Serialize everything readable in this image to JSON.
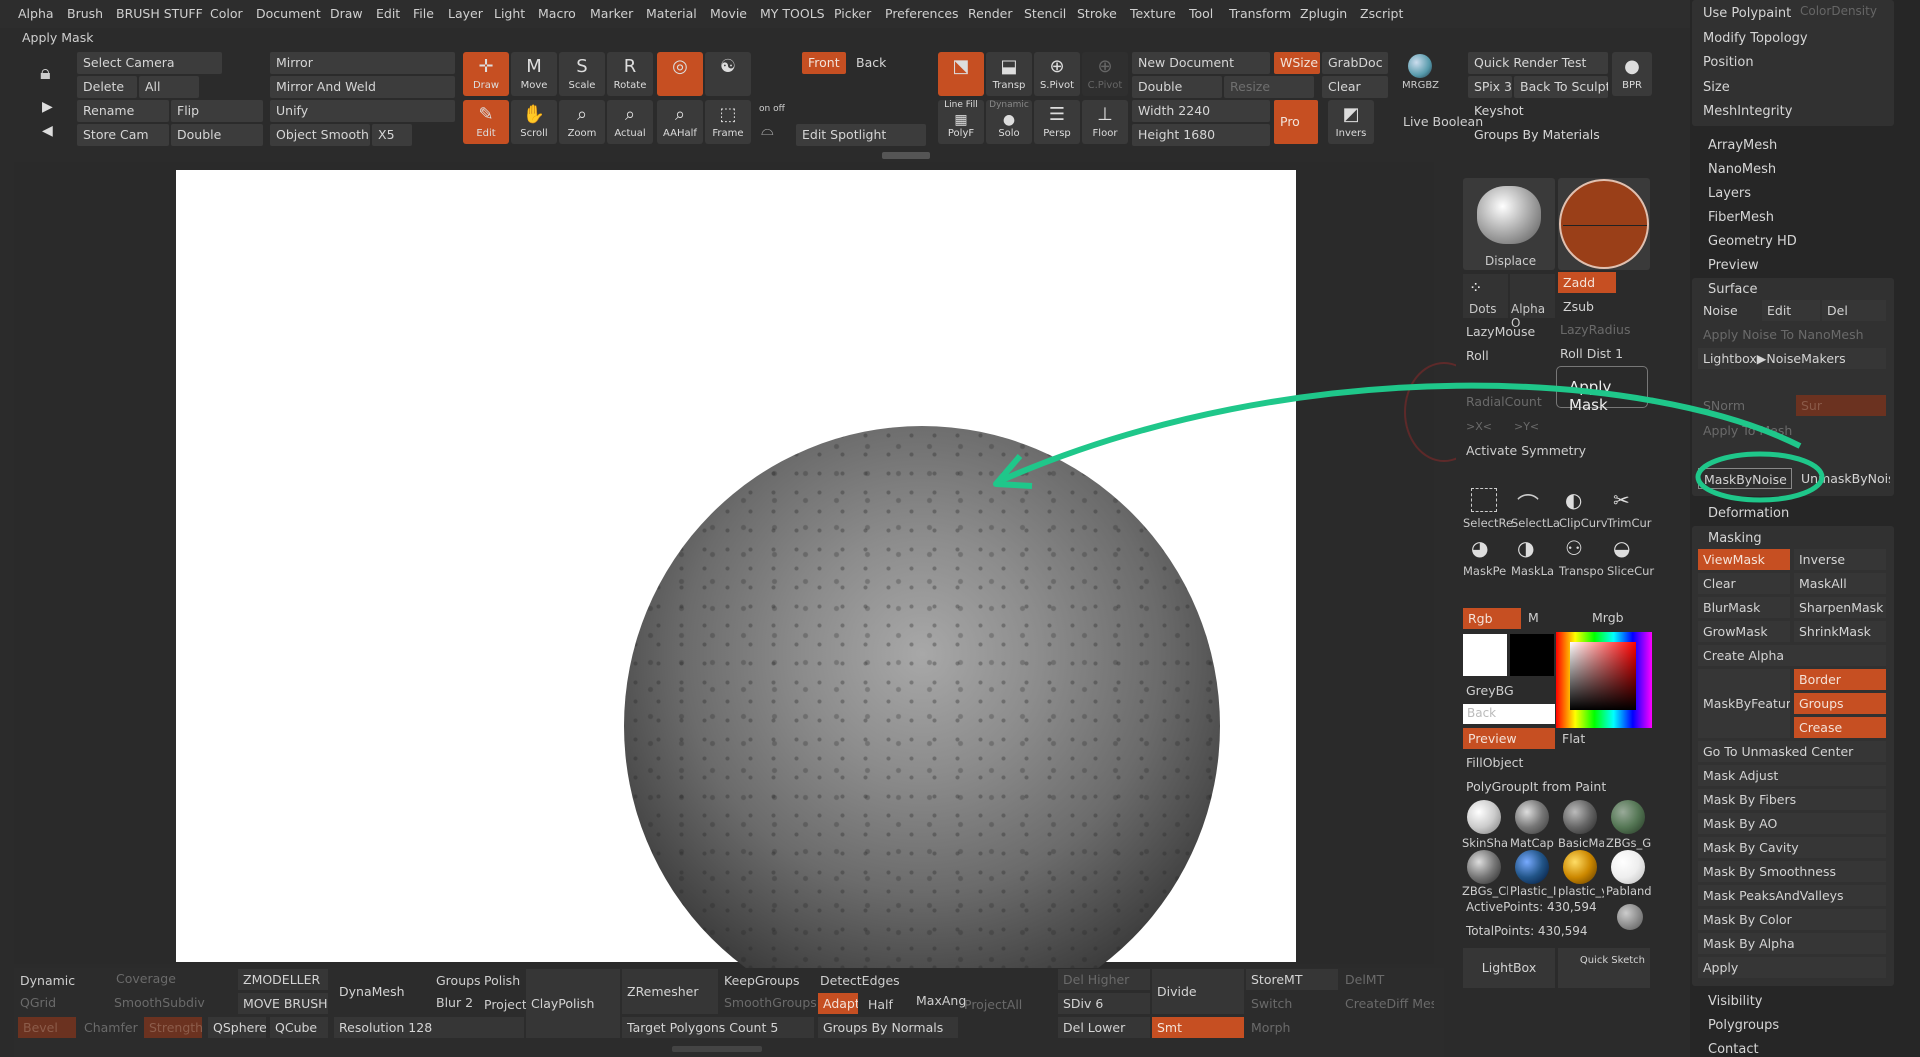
{
  "menu": [
    "Alpha",
    "Brush",
    "BRUSH STUFF",
    "Color",
    "Document",
    "Draw",
    "Edit",
    "File",
    "Layer",
    "Light",
    "Macro",
    "Marker",
    "Material",
    "Movie",
    "MY TOOLS",
    "Picker",
    "Preferences",
    "Render",
    "Stencil",
    "Stroke",
    "Texture",
    "Tool",
    "Transform",
    "Zplugin",
    "Zscript"
  ],
  "status_title": "Apply Mask",
  "toolbar": {
    "select_camera": "Select Camera",
    "delete": "Delete",
    "all": "All",
    "rename": "Rename",
    "flip": "Flip",
    "store_cam": "Store Cam",
    "double": "Double",
    "mirror": "Mirror",
    "mirror_weld": "Mirror And Weld",
    "unify": "Unify",
    "object_smooth": "Object Smooth",
    "x5": "X5",
    "draw": "Draw",
    "move": "Move",
    "scale": "Scale",
    "rotate": "Rotate",
    "edit": "Edit",
    "scroll": "Scroll",
    "zoom": "Zoom",
    "actual": "Actual",
    "aahalf": "AAHalf",
    "frame": "Frame",
    "front": "Front",
    "back": "Back",
    "on_off": "on  off",
    "edit_spotlight": "Edit Spotlight",
    "transp": "Transp",
    "spivot": "S.Pivot",
    "cpivot": "C.Pivot",
    "line_fill": "Line Fill",
    "polyf": "PolyF",
    "dynamic_solo": "Dynamic",
    "solo": "Solo",
    "persp": "Persp",
    "floor": "Floor",
    "new_document": "New Document",
    "wsize": "WSize",
    "grabdoc": "GrabDoc",
    "double2": "Double",
    "resize": "Resize",
    "clear": "Clear",
    "width": "Width 2240",
    "height": "Height 1680",
    "pro": "Pro",
    "invers": "Invers",
    "live_boolean": "Live Boolean",
    "mrgbz": "MRGBZ",
    "quick_render": "Quick Render Test",
    "spix": "SPix 3",
    "back_to_sculpt": "Back To Sculpt",
    "bpr": "BPR",
    "keyshot": "Keyshot",
    "groups_by_materials": "Groups By Materials"
  },
  "right_panel": {
    "use_polypaint": "Use Polypaint",
    "color_density": "ColorDensity",
    "modify_topology": "Modify Topology",
    "position": "Position",
    "size": "Size",
    "mesh_integrity": "MeshIntegrity",
    "array_mesh": "ArrayMesh",
    "nano_mesh": "NanoMesh",
    "layers": "Layers",
    "fiber_mesh": "FiberMesh",
    "geometry_hd": "Geometry HD",
    "preview": "Preview",
    "surface": "Surface",
    "noise": "Noise",
    "edit": "Edit",
    "del": "Del",
    "apply_noise_nano": "Apply Noise To NanoMesh",
    "lightbox_noise": "Lightbox▶NoiseMakers",
    "snorm": "SNorm",
    "sur": "Sur",
    "apply_to_mesh": "Apply To Mesh",
    "mask_by_noise": "MaskByNoise",
    "unmask_by_noise": "UnmaskByNoise",
    "deformation": "Deformation",
    "masking": "Masking",
    "view_mask": "ViewMask",
    "inverse": "Inverse",
    "clear": "Clear",
    "mask_all": "MaskAll",
    "blur_mask": "BlurMask",
    "sharpen_mask": "SharpenMask",
    "grow_mask": "GrowMask",
    "shrink_mask": "ShrinkMask",
    "create_alpha": "Create Alpha",
    "mask_by_feature": "MaskByFeature",
    "border": "Border",
    "groups": "Groups",
    "crease": "Crease",
    "go_to_unmasked": "Go To Unmasked Center",
    "mask_adjust": "Mask Adjust",
    "mask_by_fibers": "Mask By Fibers",
    "mask_by_ao": "Mask By AO",
    "mask_by_cavity": "Mask By Cavity",
    "mask_by_smoothness": "Mask By Smoothness",
    "mask_peaks": "Mask PeaksAndValleys",
    "mask_by_color": "Mask By Color",
    "mask_by_alpha": "Mask By Alpha",
    "apply": "Apply",
    "visibility": "Visibility",
    "polygroups": "Polygroups",
    "contact": "Contact"
  },
  "tool_panel": {
    "displace": "Displace",
    "zadd": "Zadd",
    "zsub": "Zsub",
    "dots": "Dots",
    "alpha_off": "Alpha O",
    "lazy_mouse": "LazyMouse",
    "lazy_radius": "LazyRadius",
    "roll": "Roll",
    "roll_dist": "Roll Dist 1",
    "tooltip": "Apply Mask",
    "radial_count": "RadialCount",
    "x_axis": ">X<",
    "y_axis": ">Y<",
    "activate_symmetry": "Activate Symmetry",
    "sel_tools": [
      "SelectRe",
      "SelectLa",
      "ClipCurv",
      "TrimCur"
    ],
    "mask_tools": [
      "MaskPe",
      "MaskLa",
      "Transpo",
      "SliceCur"
    ],
    "rgb": "Rgb",
    "m": "M",
    "mrgb": "Mrgb",
    "grey_bg": "GreyBG",
    "back": "Back",
    "preview": "Preview",
    "flat": "Flat",
    "fill_object": "FillObject",
    "polygroup_paint": "PolyGroupIt from Paint",
    "materials_row1": [
      "SkinSha",
      "MatCap",
      "BasicMa",
      "ZBGs_G"
    ],
    "materials_row2": [
      "ZBGs_Cl",
      "Plastic_I",
      "plastic_y",
      "Pabland"
    ],
    "active_points": "ActivePoints: 430,594",
    "total_points": "TotalPoints: 430,594",
    "lightbox": "LightBox",
    "quick_sketch": "Quick Sketch"
  },
  "bottom": {
    "dynamic": "Dynamic",
    "coverage": "Coverage",
    "qgrid": "QGrid",
    "smooth_subdiv": "SmoothSubdiv",
    "bevel": "Bevel",
    "chamfer": "Chamfer",
    "strength": "Strength",
    "zmodeller": "ZMODELLER",
    "move_brush": "MOVE BRUSH",
    "qsphere": "QSphere",
    "qcube": "QCube",
    "dynamesh": "DynaMesh",
    "groups": "Groups",
    "polish": "Polish",
    "blur": "Blur 2",
    "project": "Project",
    "resolution": "Resolution 128",
    "clay_polish": "ClayPolish",
    "zremesher": "ZRemesher",
    "keep_groups": "KeepGroups",
    "smooth_groups": "SmoothGroups",
    "target_polys": "Target Polygons Count 5",
    "detect_edges": "DetectEdges",
    "adapt": "Adapt",
    "half": "Half",
    "max_angle": "MaxAng",
    "groups_by_normals": "Groups By Normals",
    "project_all": "ProjectAll",
    "del_higher": "Del Higher",
    "sdiv": "SDiv 6",
    "del_lower": "Del Lower",
    "divide": "Divide",
    "smt": "Smt",
    "store_mt": "StoreMT",
    "del_mt": "DelMT",
    "switch": "Switch",
    "create_diff_mesh": "CreateDiff Mesh",
    "morph": "Morph"
  },
  "colors": {
    "accent_orange": "#c64f22",
    "annotation_green": "#1fc78a"
  }
}
